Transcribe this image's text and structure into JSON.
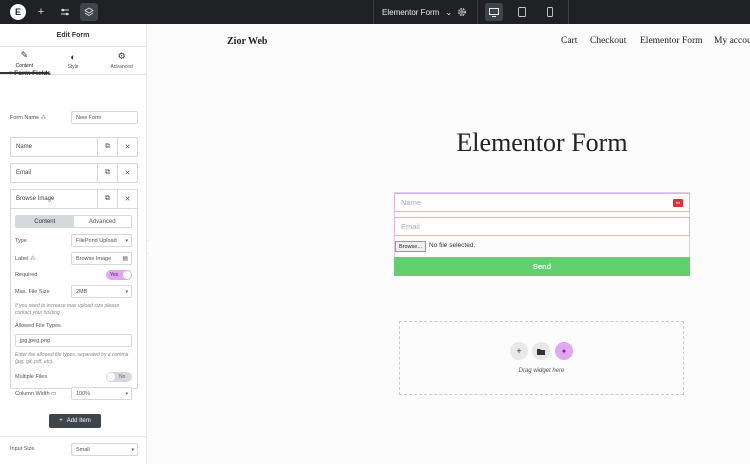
{
  "topbar": {
    "logo": "E",
    "title": "Elementor Form",
    "icons": [
      "elementor-logo-icon",
      "plus-icon",
      "sliders-icon",
      "layers-icon",
      "chevron-down-icon",
      "gear-icon",
      "desktop-icon",
      "tablet-icon",
      "mobile-icon"
    ]
  },
  "panel": {
    "title": "Edit Form",
    "tabs": [
      {
        "label": "Content",
        "icon": "pencil-icon"
      },
      {
        "label": "Style",
        "icon": "contrast-icon"
      },
      {
        "label": "Advanced",
        "icon": "gear-icon"
      }
    ],
    "section": "Form Fields",
    "form_name_label": "Form Name",
    "form_name_value": "New Form",
    "items": [
      {
        "label": "Name"
      },
      {
        "label": "Email"
      },
      {
        "label": "Browse Image"
      }
    ],
    "subtabs": [
      "Content",
      "Advanced"
    ],
    "type_label": "Type",
    "type_value": "FilePond Upload",
    "label_label": "Label",
    "label_value": "Browse Image",
    "required_label": "Required",
    "required_value": "Yes",
    "max_size_label": "Max. File Size",
    "max_size_value": "2MB",
    "max_size_help": "If you need to increase max upload size please contact your hosting.",
    "allowed_label": "Allowed File Types",
    "allowed_value": "jpg,jpeg,png",
    "allowed_help": "Enter the allowed file types, separated by a comma (jpg, gif, pdf, etc).",
    "multiple_label": "Multiple Files",
    "multiple_value": "No",
    "col_width_label": "Column Width",
    "col_width_value": "100%",
    "add_item": "Add Item",
    "input_size_label": "Input Size",
    "input_size_value": "Small"
  },
  "site": {
    "name": "Zior Web",
    "nav": [
      "Cart",
      "Checkout",
      "Elementor Form",
      "My account"
    ]
  },
  "form": {
    "title": "Elementor Form",
    "name_placeholder": "Name",
    "email_placeholder": "Email",
    "browse_label": "Browse...",
    "no_file": "No file selected.",
    "send": "Send"
  },
  "dropzone": {
    "text": "Drag widget here"
  },
  "colors": {
    "topbar": "#1f2124",
    "send": "#61ce70",
    "toggle_on": "#e2a7f3",
    "accent": "#d4b3e6"
  }
}
